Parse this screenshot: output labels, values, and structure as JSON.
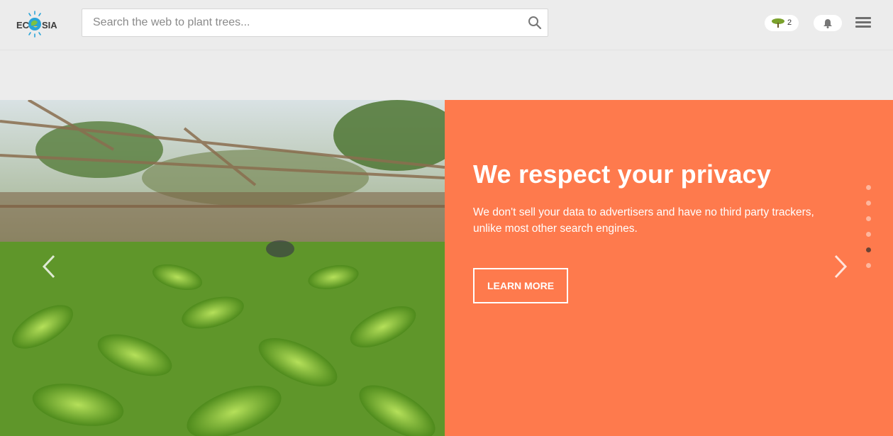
{
  "header": {
    "logo_text": "ECOSIA",
    "search": {
      "placeholder": "Search the web to plant trees...",
      "value": ""
    },
    "tree_count": "2",
    "icons": [
      "search-icon",
      "tree-icon",
      "bell-icon",
      "menu-icon"
    ]
  },
  "hero": {
    "headline": "We respect your privacy",
    "body": "We don't sell your data to advertisers and have no third party trackers, unlike most other search engines.",
    "cta_label": "LEARN MORE",
    "slides_total": 6,
    "active_slide": 5,
    "colors": {
      "panel": "#fe7a4d",
      "header_bg": "#ececec",
      "active_dot": "#6a4335"
    }
  }
}
